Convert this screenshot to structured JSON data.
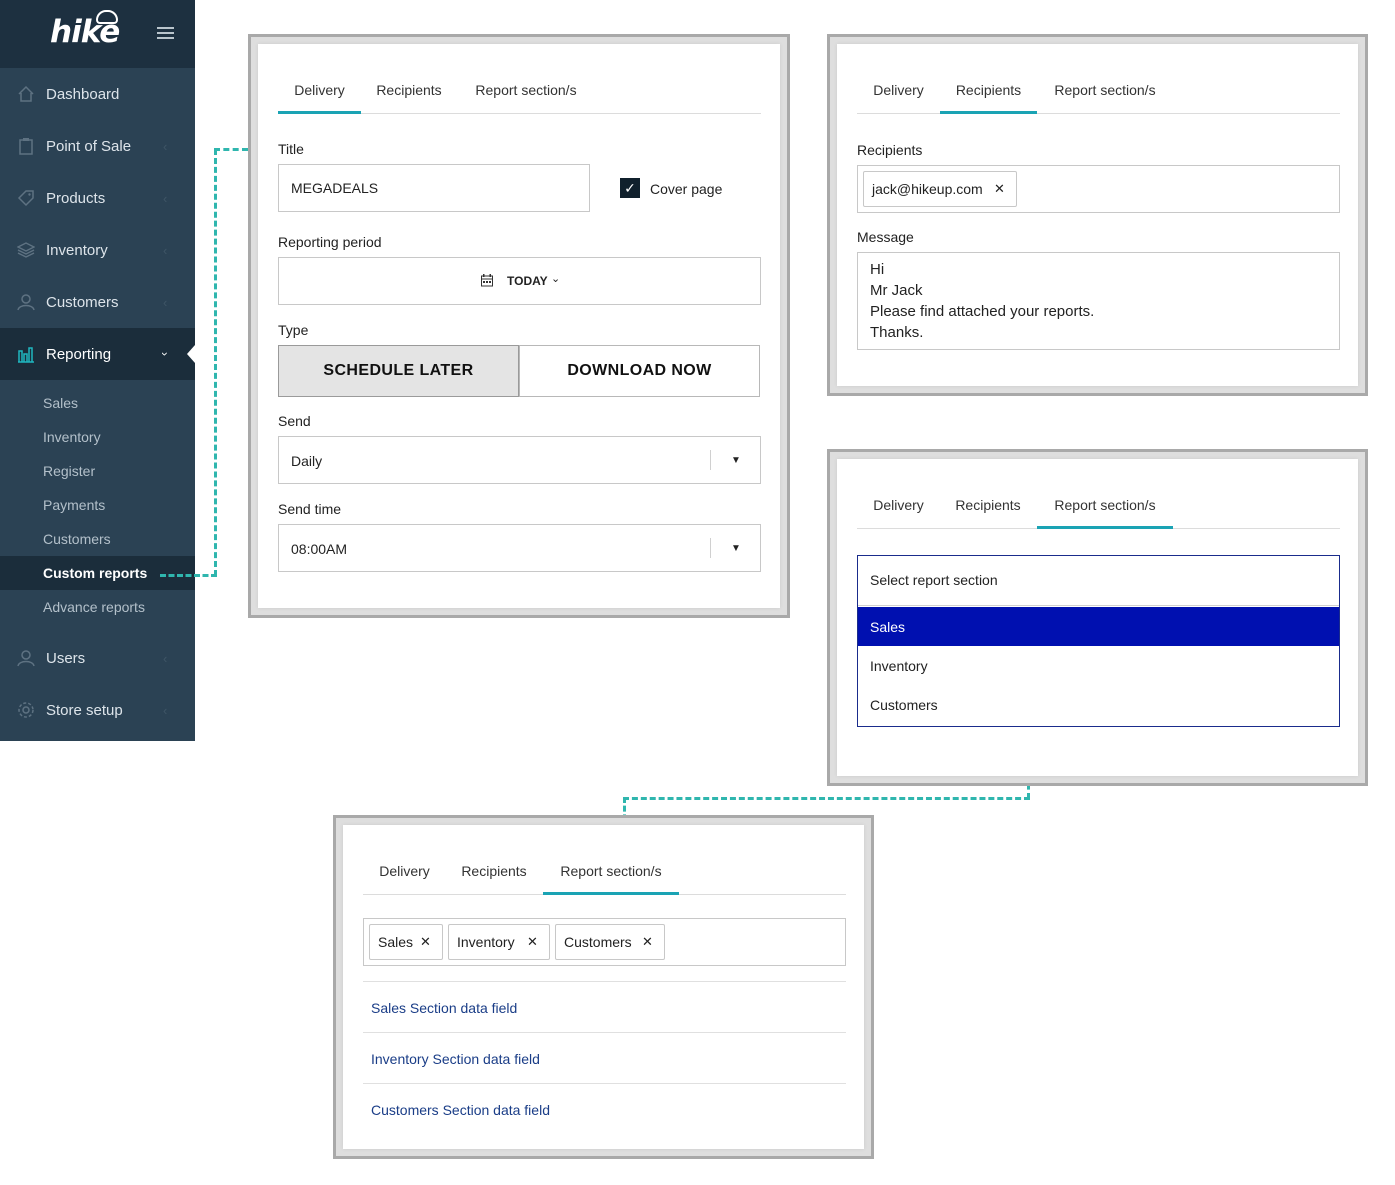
{
  "app": {
    "logo": "hike"
  },
  "sidebar": {
    "items": [
      {
        "label": "Dashboard",
        "icon": "home-icon"
      },
      {
        "label": "Point of Sale",
        "icon": "clipboard-icon"
      },
      {
        "label": "Products",
        "icon": "tag-icon"
      },
      {
        "label": "Inventory",
        "icon": "layers-icon"
      },
      {
        "label": "Customers",
        "icon": "user-icon"
      },
      {
        "label": "Reporting",
        "icon": "bar-chart-icon",
        "active": true
      },
      {
        "label": "Users",
        "icon": "user-icon"
      },
      {
        "label": "Store setup",
        "icon": "gear-icon"
      }
    ],
    "reporting_subitems": [
      "Sales",
      "Inventory",
      "Register",
      "Payments",
      "Customers",
      "Custom reports",
      "Advance reports"
    ],
    "current_subitem": "Custom reports"
  },
  "tabs": {
    "delivery": "Delivery",
    "recipients": "Recipients",
    "report_sections": "Report section/s"
  },
  "delivery_panel": {
    "title_label": "Title",
    "title_value": "MEGADEALS",
    "cover_page_label": "Cover page",
    "cover_page_checked": true,
    "reporting_period_label": "Reporting period",
    "reporting_period_value": "TODAY",
    "type_label": "Type",
    "type_options": [
      "SCHEDULE LATER",
      "DOWNLOAD NOW"
    ],
    "type_selected": "SCHEDULE LATER",
    "send_label": "Send",
    "send_value": "Daily",
    "send_time_label": "Send time",
    "send_time_value": "08:00AM"
  },
  "recipients_panel": {
    "recipients_label": "Recipients",
    "recipient_chip": "jack@hikeup.com",
    "message_label": "Message",
    "message_lines": [
      "Hi",
      "Mr Jack",
      "Please find attached your reports.",
      "Thanks."
    ]
  },
  "section_select_panel": {
    "placeholder": "Select report section",
    "options": [
      "Sales",
      "Inventory",
      "Customers"
    ],
    "highlighted": "Sales"
  },
  "sections_result_panel": {
    "chips": [
      "Sales",
      "Inventory",
      "Customers"
    ],
    "fields": [
      "Sales Section data field",
      "Inventory Section data field",
      "Customers Section data field"
    ]
  },
  "colors": {
    "sidebar_bg": "#2b4254",
    "sidebar_header_bg": "#1d3040",
    "accent": "#1aa3b4",
    "connector": "#2fb6ae",
    "dropdown_highlight": "#0010b0",
    "link": "#1a3d87"
  }
}
